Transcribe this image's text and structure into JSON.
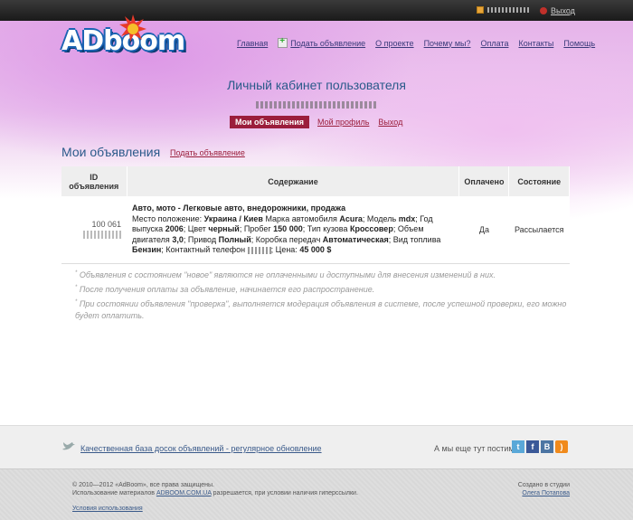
{
  "topbar": {
    "logout_label": "Выход"
  },
  "header": {
    "logo_text": "ADboom",
    "nav": [
      {
        "label": "Главная"
      },
      {
        "label": "Подать объявление"
      },
      {
        "label": "О проекте"
      },
      {
        "label": "Почему мы?"
      },
      {
        "label": "Оплата"
      },
      {
        "label": "Контакты"
      },
      {
        "label": "Помощь"
      }
    ]
  },
  "cabinet": {
    "title": "Личный кабинет пользователя",
    "tabs": [
      {
        "label": "Мои объявления",
        "active": true
      },
      {
        "label": "Мой профиль",
        "active": false
      },
      {
        "label": "Выход",
        "active": false
      }
    ]
  },
  "section": {
    "title": "Мои объявления",
    "add_link": "Подать объявление"
  },
  "table": {
    "headers": [
      "ID объявления",
      "Содержание",
      "Оплачено",
      "Состояние"
    ],
    "rows": [
      {
        "id": "100 061",
        "category": "Авто, мото - Легковые авто, внедорожники, продажа",
        "location_label": "Место положение:",
        "location": "Украина / Киев",
        "brand_label": "Марка автомобиля",
        "brand": "Acura",
        "model_label": "Модель",
        "model": "mdx",
        "year_label": "Год выпуска",
        "year": "2006",
        "color_label": "Цвет",
        "color": "черный",
        "mileage_label": "Пробег",
        "mileage": "150 000",
        "body_label": "Тип кузова",
        "body": "Кроссовер",
        "engine_label": "Объем двигателя",
        "engine": "3,0",
        "drive_label": "Привод",
        "drive": "Полный",
        "gearbox_label": "Коробка передач",
        "gearbox": "Автоматическая",
        "fuel_label": "Вид топлива",
        "fuel": "Бензин",
        "phone_label": "Контактный телефон",
        "price_label": "Цена:",
        "price": "45 000 $",
        "paid": "Да",
        "status": "Рассылается"
      }
    ]
  },
  "notes": [
    "Объявления с состоянием \"новое\" являются не оплаченными и доступными для внесения изменений в них.",
    "После получения оплаты за объявление, начинается его распространение.",
    "При состоянии объявления \"проверка\", выполняется модерация объявления в системе, после успешной проверки, его можно будет оплатить."
  ],
  "footer": {
    "tagline": "Качественная база досок объявлений - регулярное обновление",
    "social_label": "А мы еще тут постим:",
    "social": [
      "twitter-icon",
      "facebook-icon",
      "vkontakte-icon",
      "rss-icon"
    ],
    "copyright_line1": "© 2010—2012 «AdBoom», все права защищены.",
    "copyright_line2_pre": "Использование материалов",
    "copyright_link": "ADBOOM.COM.UA",
    "copyright_line2_post": "разрешается, при условии наличия гиперссылки.",
    "terms": "Условия использования",
    "created_label": "Создано в студии",
    "author": "Олега Потапова"
  },
  "colors": {
    "accent": "#9b1e3c",
    "title_blue": "#2a5a8a",
    "topbar": "#222222"
  }
}
